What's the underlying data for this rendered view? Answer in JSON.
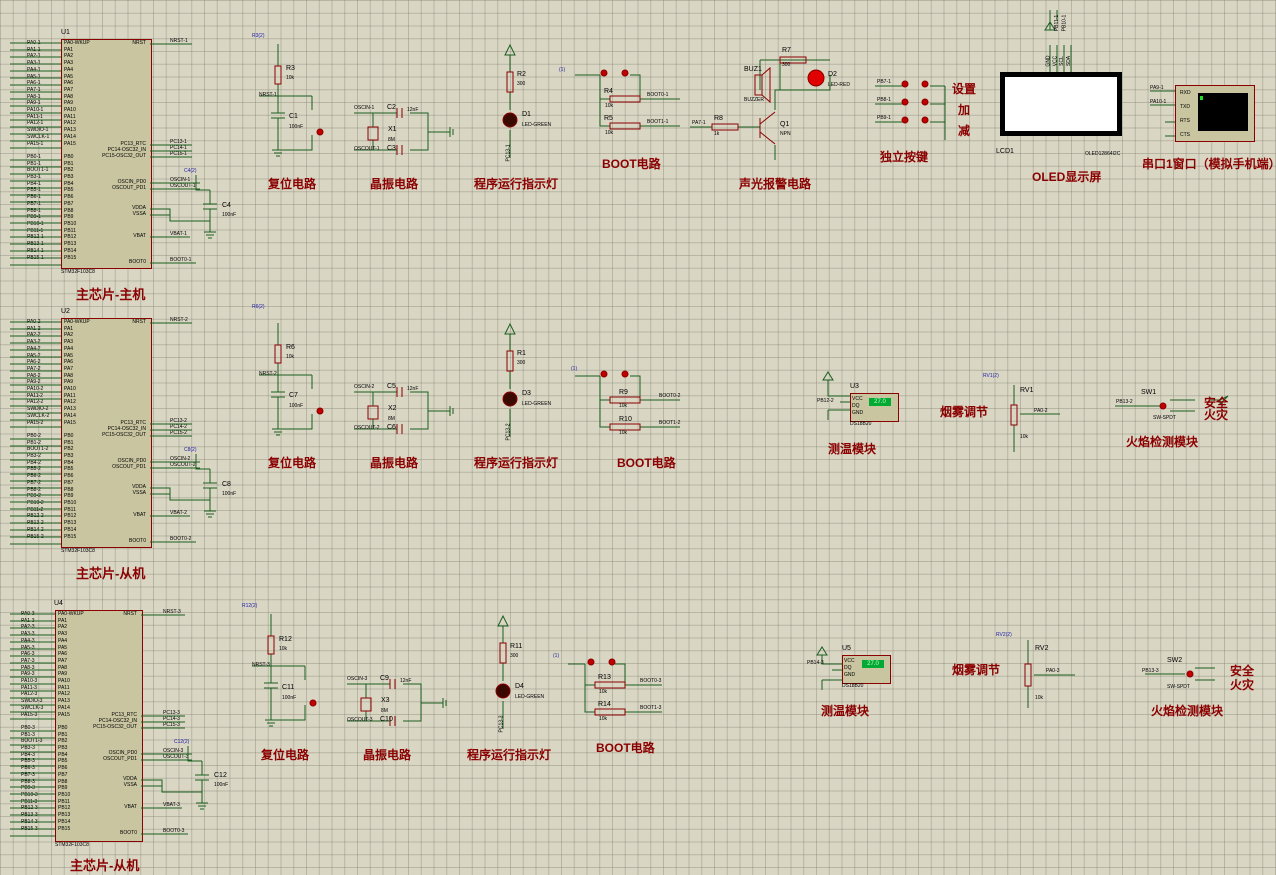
{
  "mcu_main": {
    "ref": "U1",
    "part": "STM32F103C8",
    "title": "主芯片-主机",
    "left_pins": [
      "PA0-WKUP",
      "PA1",
      "PA2",
      "PA3",
      "PA4",
      "PA5",
      "PA6",
      "PA7",
      "PA8",
      "PA9",
      "PA10",
      "PA11",
      "PA12",
      "PA13",
      "PA14",
      "PA15",
      "",
      "PB0",
      "PB1",
      "PB2",
      "PB3",
      "PB4",
      "PB5",
      "PB6",
      "PB7",
      "PB8",
      "PB9",
      "PB10",
      "PB11",
      "PB12",
      "PB13",
      "PB14",
      "PB15"
    ],
    "left_nets": [
      "PA0-1",
      "PA1-1",
      "PA2-1",
      "PA3-1",
      "PA4-1",
      "PA5-1",
      "PA6-1",
      "PA7-1",
      "PA8-1",
      "PA9-1",
      "PA10-1",
      "PA11-1",
      "PA12-1",
      "SWDIO-1",
      "SWCLK-1",
      "PA15-1",
      "",
      "PB0-1",
      "PB1-1",
      "BOOT1-1",
      "PB3-1",
      "PB4-1",
      "PB5-1",
      "PB6-1",
      "PB7-1",
      "PB8-1",
      "PB9-1",
      "PB10-1",
      "PB11-1",
      "PB12-1",
      "PB13-1",
      "PB14-1",
      "PB15-1"
    ],
    "right_pins": [
      "NRST",
      "PC13_RTC",
      "PC14-OSC32_IN",
      "PC15-OSC32_OUT",
      "OSCIN_PD0",
      "OSCOUT_PD1",
      "VDDA",
      "VSSA",
      "VBAT",
      "BOOT0"
    ],
    "right_nets": [
      "NRST-1",
      "PC13-1",
      "PC14-1",
      "PC15-1",
      "OSCIN-1",
      "OSCOUT-1",
      "",
      "",
      "VBAT-1",
      "BOOT0-1"
    ],
    "cap_ref": "C4",
    "cap_val": "100nF",
    "cap_tag": "C4(2)"
  },
  "mcu_slave1": {
    "ref": "U2",
    "part": "STM32F103C8",
    "title": "主芯片-从机",
    "left_nets": [
      "PA0-2",
      "PA1-2",
      "PA2-2",
      "PA3-2",
      "PA4-2",
      "PA5-2",
      "PA6-2",
      "PA7-2",
      "PA8-2",
      "PA9-2",
      "PA10-2",
      "PA11-2",
      "PA12-2",
      "SWDIO-2",
      "SWCLK-2",
      "PA15-2",
      "",
      "PB0-2",
      "PB1-2",
      "BOOT1-2",
      "PB3-2",
      "PB4-2",
      "PB5-2",
      "PB6-2",
      "PB7-2",
      "PB8-2",
      "PB9-2",
      "PB10-2",
      "PB11-2",
      "PB12-2",
      "PB13-2",
      "PB14-2",
      "PB15-2"
    ],
    "right_nets": [
      "NRST-2",
      "PC13-2",
      "PC14-2",
      "PC15-2",
      "OSCIN-2",
      "OSCOUT-2",
      "",
      "",
      "VBAT-2",
      "BOOT0-2"
    ],
    "cap_ref": "C8",
    "cap_val": "100nF",
    "cap_tag": "C8(2)"
  },
  "mcu_slave2": {
    "ref": "U4",
    "part": "STM32F103C8",
    "title": "主芯片-从机",
    "left_nets": [
      "PA0-3",
      "PA1-3",
      "PA2-3",
      "PA3-3",
      "PA4-3",
      "PA5-3",
      "PA6-3",
      "PA7-3",
      "PA8-3",
      "PA9-3",
      "PA10-3",
      "PA11-3",
      "PA12-3",
      "SWDIO-3",
      "SWCLK-3",
      "PA15-3",
      "",
      "PB0-3",
      "PB1-3",
      "BOOT1-3",
      "PB3-3",
      "PB4-3",
      "PB5-3",
      "PB6-3",
      "PB7-3",
      "PB8-3",
      "PB9-3",
      "PB10-3",
      "PB11-3",
      "PB12-3",
      "PB13-3",
      "PB14-3",
      "PB15-3"
    ],
    "right_nets": [
      "NRST-3",
      "PC13-3",
      "PC14-3",
      "PC15-3",
      "OSCIN-3",
      "OSCOUT-3",
      "",
      "",
      "VBAT-3",
      "BOOT0-3"
    ],
    "cap_ref": "C12",
    "cap_val": "100nF",
    "cap_tag": "C12(2)"
  },
  "blocks": {
    "reset1": {
      "title": "复位电路",
      "r": "R3",
      "rv": "10k",
      "c": "C1",
      "cv": "100nF",
      "net": "NRST-1",
      "tag": "R3(2)"
    },
    "reset2": {
      "title": "复位电路",
      "r": "R6",
      "rv": "10k",
      "c": "C7",
      "cv": "100nF",
      "net": "NRST-2",
      "tag": "R6(2)"
    },
    "reset3": {
      "title": "复位电路",
      "r": "R12",
      "rv": "10k",
      "c": "C11",
      "cv": "100nF",
      "net": "NRST-3",
      "tag": "R12(2)"
    },
    "xtal1": {
      "title": "晶振电路",
      "x": "X1",
      "xv": "8M",
      "c1": "C2",
      "c2": "C3",
      "cv": "12nF",
      "n1": "OSCIN-1",
      "n2": "OSCOUT-1"
    },
    "xtal2": {
      "title": "晶振电路",
      "x": "X2",
      "xv": "8M",
      "c1": "C5",
      "c2": "C6",
      "cv": "12nF",
      "n1": "OSCIN-2",
      "n2": "OSCOUT-2"
    },
    "xtal3": {
      "title": "晶振电路",
      "x": "X3",
      "xv": "8M",
      "c1": "C9",
      "c2": "C10",
      "cv": "12nF",
      "n1": "OSCIN-3",
      "n2": "OSCOUT-3"
    },
    "led1": {
      "title": "程序运行指示灯",
      "r": "R2",
      "rv": "300",
      "d": "D1",
      "dv": "LED-GREEN",
      "net": "PC13-1"
    },
    "led2": {
      "title": "程序运行指示灯",
      "r": "R1",
      "rv": "300",
      "d": "D3",
      "dv": "LED-GREEN",
      "net": "PC13-2"
    },
    "led3": {
      "title": "程序运行指示灯",
      "r": "R11",
      "rv": "300",
      "d": "D4",
      "dv": "LED-GREEN",
      "net": "PC13-3"
    },
    "boot1": {
      "title": "BOOT电路",
      "r1": "R4",
      "r2": "R5",
      "rv": "10k",
      "n1": "BOOT0-1",
      "n2": "BOOT1-1",
      "tag": "(1)"
    },
    "boot2": {
      "title": "BOOT电路",
      "r1": "R9",
      "r2": "R10",
      "rv": "10k",
      "n1": "BOOT0-2",
      "n2": "BOOT1-2",
      "tag": "(1)"
    },
    "boot3": {
      "title": "BOOT电路",
      "r1": "R13",
      "r2": "R14",
      "rv": "10k",
      "n1": "BOOT0-3",
      "n2": "BOOT1-3",
      "tag": "(1)"
    },
    "alarm": {
      "title": "声光报警电路",
      "buz": "BUZ1",
      "buzv": "BUZZER",
      "r7": "R7",
      "r7v": "300",
      "d2": "D2",
      "d2v": "LED-RED",
      "r8": "R8",
      "r8v": "1k",
      "q": "Q1",
      "qv": "NPN",
      "net": "PA7-1"
    },
    "keys": {
      "title": "独立按键",
      "nets": [
        "PB7-1",
        "PB8-1",
        "PB9-1"
      ],
      "labels": [
        "设置",
        "加",
        "减"
      ]
    },
    "oled": {
      "title": "OLED显示屏",
      "ref": "LCD1",
      "part": "OLED12864I2C",
      "pins": [
        "GND",
        "VCC",
        "SCL",
        "SDA"
      ],
      "nets": [
        "PB11-1",
        "PB10-1"
      ]
    },
    "uart": {
      "title": "串口1窗口（模拟手机端）",
      "pins": [
        "RXD",
        "TXD",
        "RTS",
        "CTS"
      ],
      "nets": [
        "PA9-1",
        "PA10-1"
      ]
    },
    "temp1": {
      "title": "测温模块",
      "ref": "U3",
      "part": "DS18B20",
      "pins": [
        "VCC",
        "DQ",
        "GND"
      ],
      "reading": "27.0",
      "net": "PB12-2"
    },
    "temp2": {
      "title": "测温模块",
      "ref": "U5",
      "part": "DS18B20",
      "pins": [
        "VCC",
        "DQ",
        "GND"
      ],
      "reading": "27.0",
      "net": "PB14-3"
    },
    "smoke1": {
      "title": "烟雾调节",
      "ref": "RV1",
      "val": "10k",
      "net": "PA0-2",
      "tag": "RV1(2)"
    },
    "smoke2": {
      "title": "烟雾调节",
      "ref": "RV2",
      "val": "10k",
      "net": "PA0-3",
      "tag": "RV2(2)"
    },
    "flame1": {
      "title": "火焰检测模块",
      "ref": "SW1",
      "part": "SW-SPDT",
      "net": "PB13-2",
      "l1": "安全",
      "l2": "火灾"
    },
    "flame2": {
      "title": "火焰检测模块",
      "ref": "SW2",
      "part": "SW-SPDT",
      "net": "PB13-3",
      "l1": "安全",
      "l2": "火灾"
    }
  }
}
